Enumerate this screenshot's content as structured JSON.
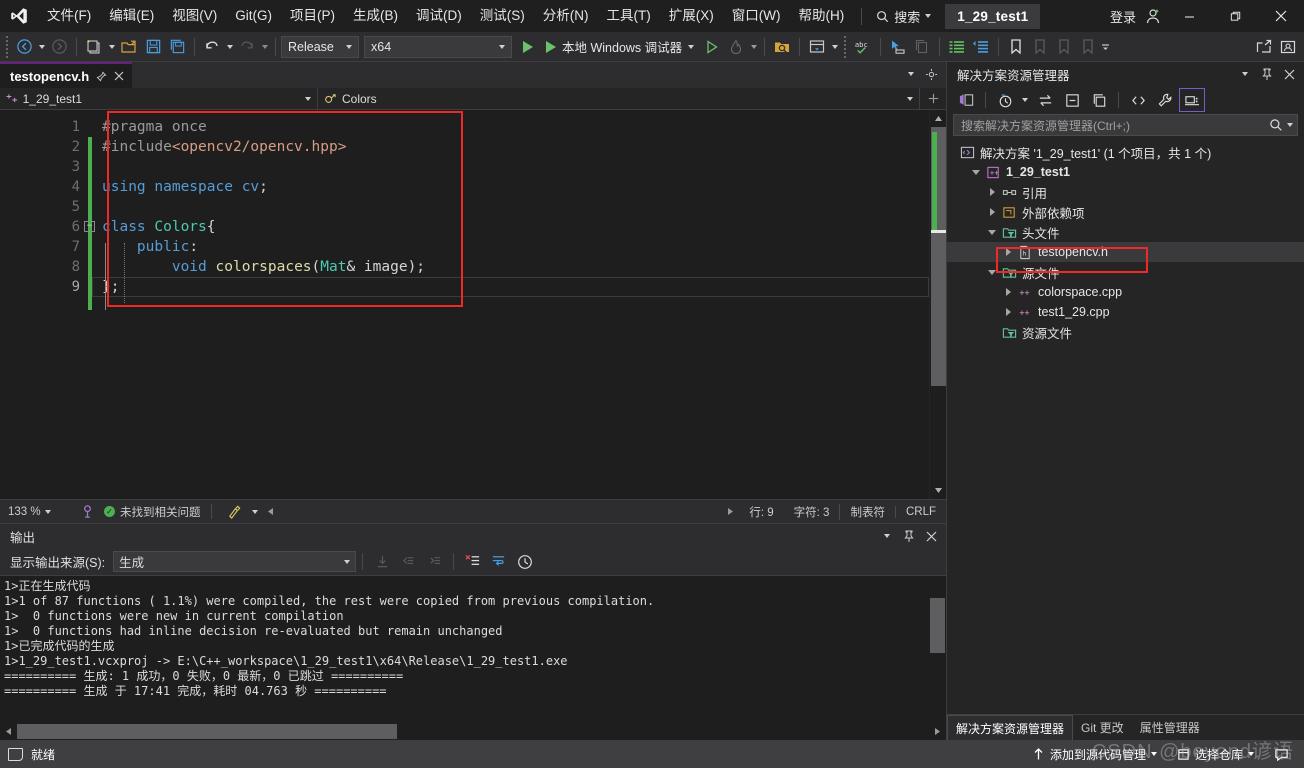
{
  "titlebar": {
    "logo_name": "visual-studio-logo",
    "menus": [
      "文件(F)",
      "编辑(E)",
      "视图(V)",
      "Git(G)",
      "项目(P)",
      "生成(B)",
      "调试(D)",
      "测试(S)",
      "分析(N)",
      "工具(T)",
      "扩展(X)",
      "窗口(W)",
      "帮助(H)"
    ],
    "search_label": "搜索",
    "project_chip": "1_29_test1",
    "signin_label": "登录",
    "minimize": "−",
    "maximize": "❐",
    "close": "✕"
  },
  "toolbar": {
    "config": "Release",
    "platform": "x64",
    "debug_target": "本地 Windows 调试器"
  },
  "editor": {
    "tab_label": "testopencv.h",
    "nav_project": "1_29_test1",
    "nav_scope": "Colors",
    "line_numbers": [
      "1",
      "2",
      "3",
      "4",
      "5",
      "6",
      "7",
      "8",
      "9"
    ],
    "code_lines": [
      {
        "n": 1,
        "tokens": [
          {
            "t": "#pragma once",
            "c": "pp"
          }
        ]
      },
      {
        "n": 2,
        "tokens": [
          {
            "t": "#include",
            "c": "pp"
          },
          {
            "t": "<opencv2/opencv.hpp>",
            "c": "str"
          }
        ]
      },
      {
        "n": 3,
        "tokens": []
      },
      {
        "n": 4,
        "tokens": [
          {
            "t": "using",
            "c": "k"
          },
          {
            "t": " ",
            "c": "pl"
          },
          {
            "t": "namespace",
            "c": "k"
          },
          {
            "t": " ",
            "c": "pl"
          },
          {
            "t": "cv",
            "c": "k"
          },
          {
            "t": ";",
            "c": "pl"
          }
        ]
      },
      {
        "n": 5,
        "tokens": []
      },
      {
        "n": 6,
        "tokens": [
          {
            "t": "class",
            "c": "k"
          },
          {
            "t": " ",
            "c": "pl"
          },
          {
            "t": "Colors",
            "c": "typ"
          },
          {
            "t": "{",
            "c": "pl"
          }
        ]
      },
      {
        "n": 7,
        "tokens": [
          {
            "t": "    ",
            "c": "pl"
          },
          {
            "t": "public",
            "c": "k"
          },
          {
            "t": ":",
            "c": "pl"
          }
        ]
      },
      {
        "n": 8,
        "tokens": [
          {
            "t": "        ",
            "c": "pl"
          },
          {
            "t": "void",
            "c": "k"
          },
          {
            "t": " ",
            "c": "pl"
          },
          {
            "t": "colorspaces",
            "c": "fn"
          },
          {
            "t": "(",
            "c": "pl"
          },
          {
            "t": "Mat",
            "c": "typ"
          },
          {
            "t": "& image);",
            "c": "pl"
          }
        ]
      },
      {
        "n": 9,
        "tokens": [
          {
            "t": "};",
            "c": "pl"
          }
        ]
      }
    ],
    "status": {
      "zoom": "133 %",
      "issues": "未找到相关问题",
      "line": "行: 9",
      "char": "字符: 3",
      "tab_mode": "制表符",
      "eol": "CRLF"
    }
  },
  "output": {
    "title": "输出",
    "source_label": "显示输出来源(S):",
    "source_value": "生成",
    "lines": [
      "1>正在生成代码",
      "1>1 of 87 functions ( 1.1%) were compiled, the rest were copied from previous compilation.",
      "1>  0 functions were new in current compilation",
      "1>  0 functions had inline decision re-evaluated but remain unchanged",
      "1>已完成代码的生成",
      "1>1_29_test1.vcxproj -> E:\\C++_workspace\\1_29_test1\\x64\\Release\\1_29_test1.exe",
      "========== 生成: 1 成功，0 失败，0 最新，0 已跳过 ==========",
      "========== 生成 于 17:41 完成，耗时 04.763 秒 =========="
    ]
  },
  "solution_explorer": {
    "title": "解决方案资源管理器",
    "search_placeholder": "搜索解决方案资源管理器(Ctrl+;)",
    "solution_line": "解决方案 '1_29_test1' (1 个项目，共 1 个)",
    "tree": [
      {
        "label": "1_29_test1",
        "indent": 1,
        "twisty": "down",
        "icon": "cpp-project-icon",
        "bold": true,
        "selected": false
      },
      {
        "label": "引用",
        "indent": 2,
        "twisty": "right",
        "icon": "references-icon",
        "bold": false,
        "selected": false
      },
      {
        "label": "外部依赖项",
        "indent": 2,
        "twisty": "right",
        "icon": "external-deps-icon",
        "bold": false,
        "selected": false
      },
      {
        "label": "头文件",
        "indent": 2,
        "twisty": "down",
        "icon": "filter-folder-icon",
        "bold": false,
        "selected": false
      },
      {
        "label": "testopencv.h",
        "indent": 3,
        "twisty": "right",
        "icon": "header-file-icon",
        "bold": false,
        "selected": true
      },
      {
        "label": "源文件",
        "indent": 2,
        "twisty": "down",
        "icon": "filter-folder-icon",
        "bold": false,
        "selected": false
      },
      {
        "label": "colorspace.cpp",
        "indent": 3,
        "twisty": "right",
        "icon": "cpp-file-icon",
        "bold": false,
        "selected": false
      },
      {
        "label": "test1_29.cpp",
        "indent": 3,
        "twisty": "right",
        "icon": "cpp-file-icon",
        "bold": false,
        "selected": false
      },
      {
        "label": "资源文件",
        "indent": 2,
        "twisty": "none",
        "icon": "filter-folder-icon",
        "bold": false,
        "selected": false
      }
    ],
    "bottom_tabs": [
      "解决方案资源管理器",
      "Git 更改",
      "属性管理器"
    ]
  },
  "statusbar": {
    "ready": "就绪",
    "add_to_source_control": "添加到源代码管理",
    "select_repo": "选择仓库",
    "watermark": "CSDN @beyond谚语"
  },
  "colors": {
    "accent_purple": "#68217a",
    "green": "#4caf50",
    "red_annotation": "#ef2929",
    "editor_bg": "#1e1e1e",
    "chrome_bg": "#2d2d30",
    "status_bg": "#3f3f41"
  }
}
